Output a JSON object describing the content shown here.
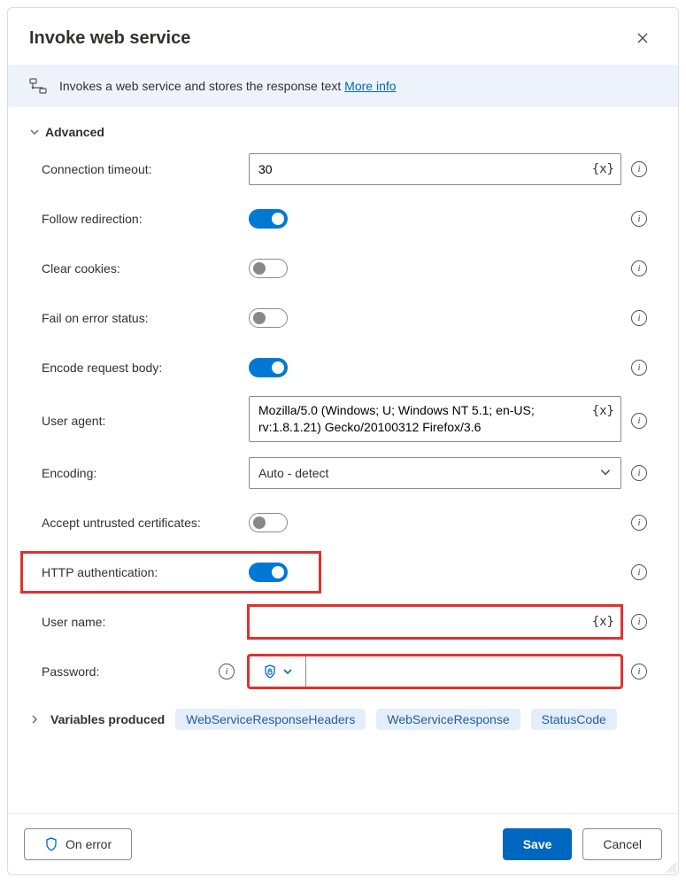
{
  "dialog": {
    "title": "Invoke web service",
    "banner_text": "Invokes a web service and stores the response text",
    "more_info": "More info"
  },
  "section": {
    "advanced": "Advanced"
  },
  "labels": {
    "connection_timeout": "Connection timeout:",
    "follow_redirection": "Follow redirection:",
    "clear_cookies": "Clear cookies:",
    "fail_on_error": "Fail on error status:",
    "encode_request": "Encode request body:",
    "user_agent": "User agent:",
    "encoding": "Encoding:",
    "accept_untrusted": "Accept untrusted certificates:",
    "http_auth": "HTTP authentication:",
    "user_name": "User name:",
    "password": "Password:",
    "variables_produced": "Variables produced"
  },
  "values": {
    "connection_timeout": "30",
    "follow_redirection": true,
    "clear_cookies": false,
    "fail_on_error": false,
    "encode_request": true,
    "user_agent": "Mozilla/5.0 (Windows; U; Windows NT 5.1; en-US; rv:1.8.1.21) Gecko/20100312 Firefox/3.6",
    "encoding": "Auto - detect",
    "accept_untrusted": false,
    "http_auth": true,
    "user_name": "",
    "password": ""
  },
  "var_token": "{x}",
  "variables": [
    "WebServiceResponseHeaders",
    "WebServiceResponse",
    "StatusCode"
  ],
  "footer": {
    "on_error": "On error",
    "save": "Save",
    "cancel": "Cancel"
  }
}
